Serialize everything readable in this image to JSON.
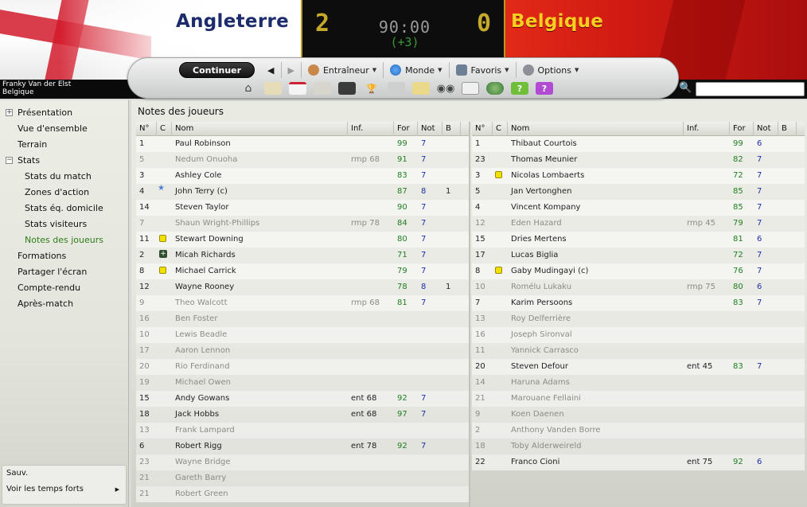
{
  "match": {
    "home_team": "Angleterre",
    "away_team": "Belgique",
    "home_score": "2",
    "away_score": "0",
    "clock": "90:00",
    "added_time": "(+3)"
  },
  "toolbar": {
    "continue_label": "Continuer",
    "back_icon": "back-arrow-icon",
    "forward_icon": "forward-arrow-icon",
    "menus": [
      {
        "label": "Entraîneur",
        "icon": "manager-icon"
      },
      {
        "label": "Monde",
        "icon": "globe-icon"
      },
      {
        "label": "Favoris",
        "icon": "favorites-icon"
      },
      {
        "label": "Options",
        "icon": "options-icon"
      }
    ],
    "quick_icons": [
      "home-icon",
      "inbox-icon",
      "calendar-icon",
      "squad-icon",
      "tactics-icon",
      "trophy-icon",
      "scout-icon",
      "notes-icon",
      "binoculars-icon",
      "newspaper-icon",
      "globe-icon",
      "help-icon",
      "help-purple-icon"
    ]
  },
  "manager": {
    "name": "Franky Van der Elst",
    "team": "Belgique"
  },
  "search": {
    "placeholder": ""
  },
  "sidebar": {
    "items": [
      {
        "label": "Présentation",
        "level": 0,
        "expander": "+"
      },
      {
        "label": "Vue d'ensemble",
        "level": 0
      },
      {
        "label": "Terrain",
        "level": 0
      },
      {
        "label": "Stats",
        "level": 0,
        "expander": "−"
      },
      {
        "label": "Stats du match",
        "level": 1
      },
      {
        "label": "Zones d'action",
        "level": 1
      },
      {
        "label": "Stats éq. domicile",
        "level": 1
      },
      {
        "label": "Stats visiteurs",
        "level": 1
      },
      {
        "label": "Notes des joueurs",
        "level": 1,
        "active": true
      },
      {
        "label": "Formations",
        "level": 0
      },
      {
        "label": "Partager l'écran",
        "level": 0
      },
      {
        "label": "Compte-rendu",
        "level": 0
      },
      {
        "label": "Après-match",
        "level": 0
      }
    ],
    "footer": {
      "save_label": "Sauv.",
      "speed_label": "Voir les temps forts"
    }
  },
  "panel": {
    "title": "Notes des joueurs",
    "columns": {
      "num": "N°",
      "c": "C",
      "name": "Nom",
      "inf": "Inf.",
      "for": "For",
      "not": "Not",
      "b": "B"
    }
  },
  "home_players": [
    {
      "num": "1",
      "name": "Paul Robinson",
      "inf": "",
      "for": "99",
      "not": "7",
      "b": "",
      "icon": "",
      "sub": false
    },
    {
      "num": "5",
      "name": "Nedum Onuoha",
      "inf": "rmp 68",
      "for": "91",
      "not": "7",
      "b": "",
      "icon": "",
      "sub": true
    },
    {
      "num": "3",
      "name": "Ashley Cole",
      "inf": "",
      "for": "83",
      "not": "7",
      "b": "",
      "icon": "",
      "sub": false
    },
    {
      "num": "4",
      "name": "John Terry (c)",
      "inf": "",
      "for": "87",
      "not": "8",
      "b": "1",
      "icon": "star",
      "sub": false
    },
    {
      "num": "14",
      "name": "Steven Taylor",
      "inf": "",
      "for": "90",
      "not": "7",
      "b": "",
      "icon": "",
      "sub": false
    },
    {
      "num": "7",
      "name": "Shaun Wright-Phillips",
      "inf": "rmp 78",
      "for": "84",
      "not": "7",
      "b": "",
      "icon": "",
      "sub": true
    },
    {
      "num": "11",
      "name": "Stewart Downing",
      "inf": "",
      "for": "80",
      "not": "7",
      "b": "",
      "icon": "yellow",
      "sub": false
    },
    {
      "num": "2",
      "name": "Micah Richards",
      "inf": "",
      "for": "71",
      "not": "7",
      "b": "",
      "icon": "injury",
      "sub": false
    },
    {
      "num": "8",
      "name": "Michael Carrick",
      "inf": "",
      "for": "79",
      "not": "7",
      "b": "",
      "icon": "yellow",
      "sub": false
    },
    {
      "num": "12",
      "name": "Wayne Rooney",
      "inf": "",
      "for": "78",
      "not": "8",
      "b": "1",
      "icon": "",
      "sub": false
    },
    {
      "num": "9",
      "name": "Theo Walcott",
      "inf": "rmp 68",
      "for": "81",
      "not": "7",
      "b": "",
      "icon": "",
      "sub": true
    },
    {
      "num": "16",
      "name": "Ben Foster",
      "inf": "",
      "for": "",
      "not": "",
      "b": "",
      "icon": "",
      "sub": true
    },
    {
      "num": "10",
      "name": "Lewis Beadle",
      "inf": "",
      "for": "",
      "not": "",
      "b": "",
      "icon": "",
      "sub": true
    },
    {
      "num": "17",
      "name": "Aaron Lennon",
      "inf": "",
      "for": "",
      "not": "",
      "b": "",
      "icon": "",
      "sub": true
    },
    {
      "num": "20",
      "name": "Rio Ferdinand",
      "inf": "",
      "for": "",
      "not": "",
      "b": "",
      "icon": "",
      "sub": true
    },
    {
      "num": "19",
      "name": "Michael Owen",
      "inf": "",
      "for": "",
      "not": "",
      "b": "",
      "icon": "",
      "sub": true
    },
    {
      "num": "15",
      "name": "Andy Gowans",
      "inf": "ent 68",
      "for": "92",
      "not": "7",
      "b": "",
      "icon": "",
      "sub": false
    },
    {
      "num": "18",
      "name": "Jack Hobbs",
      "inf": "ent 68",
      "for": "97",
      "not": "7",
      "b": "",
      "icon": "",
      "sub": false
    },
    {
      "num": "13",
      "name": "Frank Lampard",
      "inf": "",
      "for": "",
      "not": "",
      "b": "",
      "icon": "",
      "sub": true
    },
    {
      "num": "6",
      "name": "Robert Rigg",
      "inf": "ent 78",
      "for": "92",
      "not": "7",
      "b": "",
      "icon": "",
      "sub": false
    },
    {
      "num": "23",
      "name": "Wayne Bridge",
      "inf": "",
      "for": "",
      "not": "",
      "b": "",
      "icon": "",
      "sub": true
    },
    {
      "num": "21",
      "name": "Gareth Barry",
      "inf": "",
      "for": "",
      "not": "",
      "b": "",
      "icon": "",
      "sub": true
    },
    {
      "num": "21",
      "name": "Robert Green",
      "inf": "",
      "for": "",
      "not": "",
      "b": "",
      "icon": "",
      "sub": true
    }
  ],
  "away_players": [
    {
      "num": "1",
      "name": "Thibaut Courtois",
      "inf": "",
      "for": "99",
      "not": "6",
      "b": "",
      "icon": "",
      "sub": false
    },
    {
      "num": "23",
      "name": "Thomas Meunier",
      "inf": "",
      "for": "82",
      "not": "7",
      "b": "",
      "icon": "",
      "sub": false
    },
    {
      "num": "3",
      "name": "Nicolas Lombaerts",
      "inf": "",
      "for": "72",
      "not": "7",
      "b": "",
      "icon": "yellow",
      "sub": false
    },
    {
      "num": "5",
      "name": "Jan Vertonghen",
      "inf": "",
      "for": "85",
      "not": "7",
      "b": "",
      "icon": "",
      "sub": false
    },
    {
      "num": "4",
      "name": "Vincent Kompany",
      "inf": "",
      "for": "85",
      "not": "7",
      "b": "",
      "icon": "",
      "sub": false
    },
    {
      "num": "12",
      "name": "Eden Hazard",
      "inf": "rmp 45",
      "for": "79",
      "not": "7",
      "b": "",
      "icon": "",
      "sub": true
    },
    {
      "num": "15",
      "name": "Dries Mertens",
      "inf": "",
      "for": "81",
      "not": "6",
      "b": "",
      "icon": "",
      "sub": false
    },
    {
      "num": "17",
      "name": "Lucas Biglia",
      "inf": "",
      "for": "72",
      "not": "7",
      "b": "",
      "icon": "",
      "sub": false
    },
    {
      "num": "8",
      "name": "Gaby Mudingayi (c)",
      "inf": "",
      "for": "76",
      "not": "7",
      "b": "",
      "icon": "yellow",
      "sub": false
    },
    {
      "num": "10",
      "name": "Romélu Lukaku",
      "inf": "rmp 75",
      "for": "80",
      "not": "6",
      "b": "",
      "icon": "",
      "sub": true
    },
    {
      "num": "7",
      "name": "Karim Persoons",
      "inf": "",
      "for": "83",
      "not": "7",
      "b": "",
      "icon": "",
      "sub": false
    },
    {
      "num": "13",
      "name": "Roy Delferrière",
      "inf": "",
      "for": "",
      "not": "",
      "b": "",
      "icon": "",
      "sub": true
    },
    {
      "num": "16",
      "name": "Joseph Sironval",
      "inf": "",
      "for": "",
      "not": "",
      "b": "",
      "icon": "",
      "sub": true
    },
    {
      "num": "11",
      "name": "Yannick Carrasco",
      "inf": "",
      "for": "",
      "not": "",
      "b": "",
      "icon": "",
      "sub": true
    },
    {
      "num": "20",
      "name": "Steven Defour",
      "inf": "ent 45",
      "for": "83",
      "not": "7",
      "b": "",
      "icon": "",
      "sub": false
    },
    {
      "num": "14",
      "name": "Haruna Adams",
      "inf": "",
      "for": "",
      "not": "",
      "b": "",
      "icon": "",
      "sub": true
    },
    {
      "num": "21",
      "name": "Marouane Fellaini",
      "inf": "",
      "for": "",
      "not": "",
      "b": "",
      "icon": "",
      "sub": true
    },
    {
      "num": "9",
      "name": "Koen Daenen",
      "inf": "",
      "for": "",
      "not": "",
      "b": "",
      "icon": "",
      "sub": true
    },
    {
      "num": "2",
      "name": "Anthony Vanden Borre",
      "inf": "",
      "for": "",
      "not": "",
      "b": "",
      "icon": "",
      "sub": true
    },
    {
      "num": "18",
      "name": "Toby Alderweireld",
      "inf": "",
      "for": "",
      "not": "",
      "b": "",
      "icon": "",
      "sub": true
    },
    {
      "num": "22",
      "name": "Franco Cioni",
      "inf": "ent 75",
      "for": "92",
      "not": "6",
      "b": "",
      "icon": "",
      "sub": false
    }
  ],
  "colors": {
    "home_banner": "#d21a2a",
    "away_banner": "#d01a12",
    "home_name": "#1b2b6b",
    "away_name": "#f6cf22",
    "score": "#c4a92a",
    "added_time": "#3a9a3a",
    "rating_for": "#1f7e1f",
    "rating_not": "#1d2fa8",
    "active_nav": "#2e7d18",
    "yellow_card": "#f2e000"
  }
}
